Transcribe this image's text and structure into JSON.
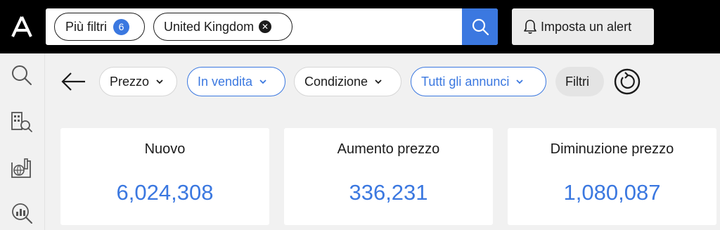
{
  "colors": {
    "accent": "#3b78e0",
    "topbar": "#000000",
    "background": "#f1f1f1"
  },
  "header": {
    "logo_icon": "brand-a-logo",
    "filters_chip": {
      "label": "Più filtri",
      "count": "6"
    },
    "country_chip": {
      "label": "United Kingdom",
      "clear_icon": "close-circle-icon"
    },
    "search_icon": "search-icon",
    "alert_button": {
      "label": "Imposta un alert",
      "icon": "bell-icon"
    }
  },
  "sidebar": {
    "items": [
      {
        "icon": "search-icon"
      },
      {
        "icon": "building-search-icon"
      },
      {
        "icon": "globe-map-icon"
      },
      {
        "icon": "chart-search-icon"
      }
    ]
  },
  "filters": {
    "back_icon": "arrow-left-icon",
    "items": [
      {
        "label": "Prezzo",
        "active": false
      },
      {
        "label": "In vendita",
        "active": true
      },
      {
        "label": "Condizione",
        "active": false
      },
      {
        "label": "Tutti gli annunci",
        "active": true
      }
    ],
    "more_label": "Filtri",
    "reset_icon": "refresh-icon"
  },
  "stats": [
    {
      "label": "Nuovo",
      "value": "6,024,308"
    },
    {
      "label": "Aumento prezzo",
      "value": "336,231"
    },
    {
      "label": "Diminuzione prezzo",
      "value": "1,080,087"
    }
  ]
}
